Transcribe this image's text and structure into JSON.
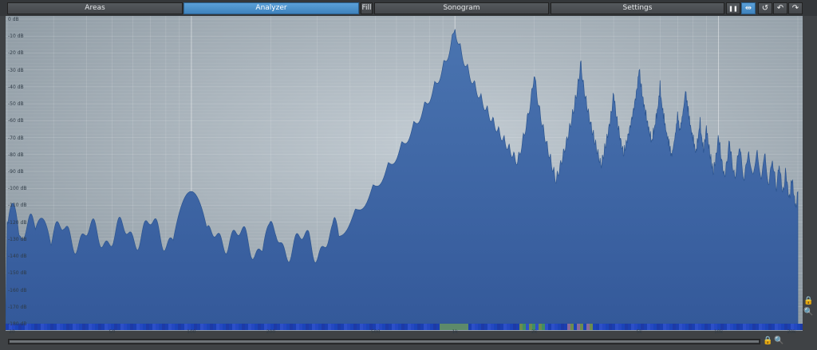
{
  "toolbar": {
    "tabs": [
      {
        "label": "Areas"
      },
      {
        "label": "Analyzer"
      },
      {
        "label": "Fill"
      },
      {
        "label": "Sonogram"
      },
      {
        "label": "Settings"
      }
    ],
    "buttons": [
      {
        "icon": "pause-icon",
        "glyph": "❚❚"
      },
      {
        "icon": "fit-icon",
        "glyph": "⇹"
      },
      {
        "icon": "reset-icon",
        "glyph": "↺"
      },
      {
        "icon": "undo-icon",
        "glyph": "↶"
      },
      {
        "icon": "redo-icon",
        "glyph": "↷"
      }
    ]
  },
  "analyzer": {
    "db_labels": [
      "0 dB",
      "-10 dB",
      "-20 dB",
      "-30 dB",
      "-40 dB",
      "-50 dB",
      "-60 dB",
      "-70 dB",
      "-80 dB",
      "-90 dB",
      "-100 dB",
      "-110 dB",
      "-120 dB",
      "-130 dB",
      "-140 dB",
      "-150 dB",
      "-160 dB",
      "-170 dB",
      "-180 dB"
    ],
    "freq_labels": [
      "20",
      "50",
      "100",
      "200",
      "500",
      "1k",
      "2k",
      "5k",
      "10k",
      "20k"
    ],
    "fill_color": "#3d66a4",
    "stroke_color": "#2c5590",
    "background_center": "#c3ccd3",
    "background_edge": "#8e9aa3",
    "peaks_hz": [
      1000,
      2000,
      3000,
      4000,
      5000,
      6000,
      7000,
      8000,
      9000,
      10000,
      11000,
      12000,
      13000,
      14000,
      15000,
      16000,
      17000,
      18000,
      19000,
      20000
    ]
  },
  "side_controls": {
    "lock_icon": "🔒",
    "zoom_icon": "🔍"
  },
  "bottom_controls": {
    "lock_icon": "🔒",
    "zoom_icon": "🔍"
  }
}
